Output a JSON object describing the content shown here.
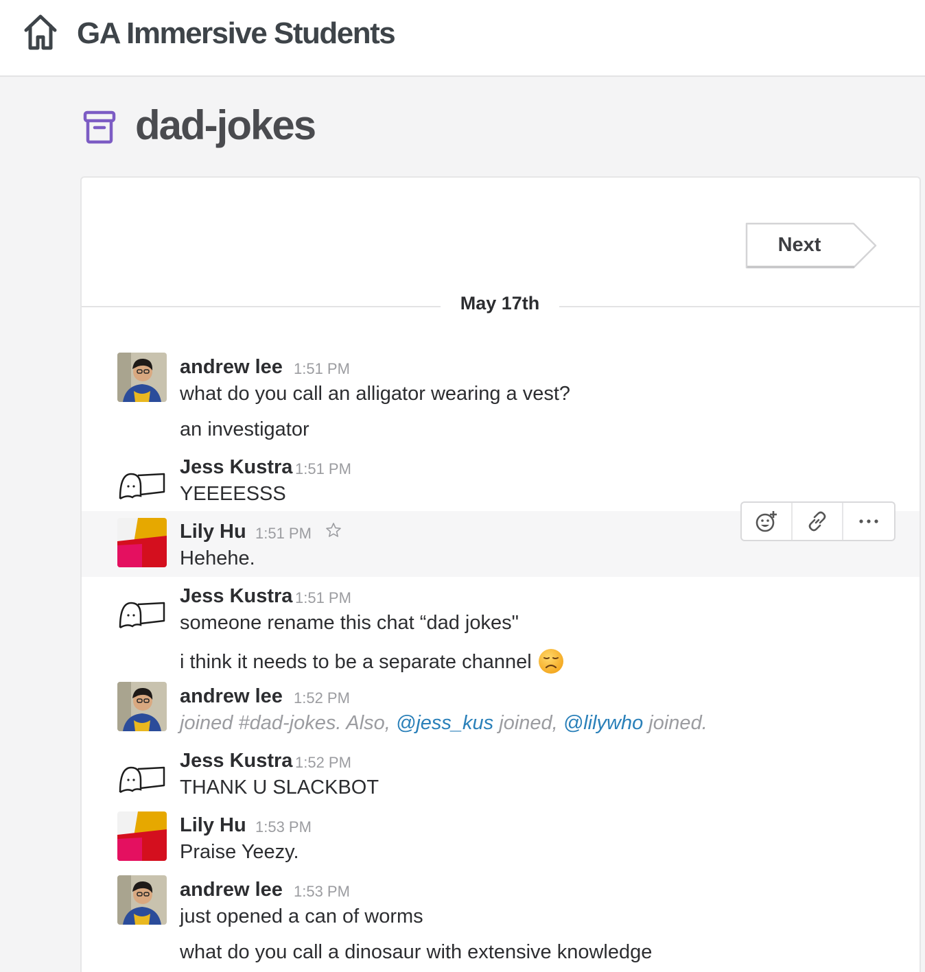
{
  "workspace": {
    "title": "GA Immersive Students"
  },
  "channel": {
    "name": "dad-jokes"
  },
  "pager": {
    "next_label": "Next"
  },
  "date_divider": "May 17th",
  "messages": [
    {
      "author": "andrew lee",
      "time": "1:51 PM",
      "lines": [
        "what do you call an alligator wearing a vest?",
        "an investigator"
      ]
    },
    {
      "author": "Jess Kustra",
      "time": "1:51 PM",
      "lines": [
        "YEEEESSS"
      ]
    },
    {
      "author": "Lily Hu",
      "time": "1:51 PM",
      "lines": [
        "Hehehe."
      ]
    },
    {
      "author": "Jess Kustra",
      "time": "1:51 PM",
      "lines": [
        "someone rename this chat “dad jokes\"",
        "i think it needs to be a separate channel"
      ]
    },
    {
      "author": "andrew lee",
      "time": "1:52 PM",
      "join": {
        "prefix": "joined #dad-jokes. Also, ",
        "mention1": "@jess_kus",
        "middle": " joined, ",
        "mention2": "@lilywho",
        "suffix": " joined."
      }
    },
    {
      "author": "Jess Kustra",
      "time": "1:52 PM",
      "lines": [
        "THANK U SLACKBOT"
      ]
    },
    {
      "author": "Lily Hu",
      "time": "1:53 PM",
      "lines": [
        "Praise Yeezy."
      ]
    },
    {
      "author": "andrew lee",
      "time": "1:53 PM",
      "lines": [
        "just opened a can of worms",
        "what do you call a dinosaur with extensive knowledge"
      ]
    }
  ],
  "icons": {
    "home": "home-icon",
    "archive": "archive-icon",
    "star": "star-icon",
    "emoji": "disappointed-face-icon",
    "add_reaction": "add-reaction-icon",
    "link": "link-icon",
    "more": "more-actions-icon"
  },
  "colors": {
    "mention": "#2a80b9",
    "archive_icon": "#7c5cc4",
    "hover_row": "#f6f6f7"
  }
}
